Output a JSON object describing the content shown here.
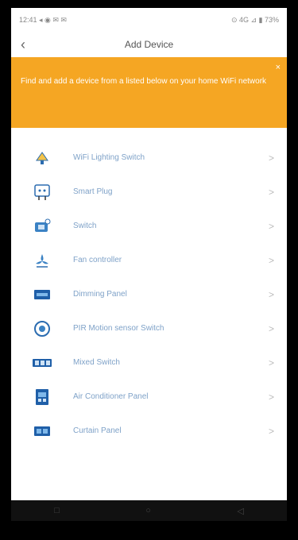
{
  "status": {
    "left": "12:41 ◂ ◉ ✉ ✉",
    "right": "⊙ 4G ⊿ ▮ 73%"
  },
  "header": {
    "title": "Add Device",
    "back_icon": "back-arrow-icon"
  },
  "banner": {
    "text": "Find and add a device from a listed below on your home WiFi network",
    "close_icon": "close-icon"
  },
  "devices": [
    {
      "label": "WiFi Lighting Switch",
      "icon": "lamp-icon"
    },
    {
      "label": "Smart Plug",
      "icon": "plug-icon"
    },
    {
      "label": "Switch",
      "icon": "switch-icon"
    },
    {
      "label": "Fan controller",
      "icon": "fan-icon"
    },
    {
      "label": "Dimming Panel",
      "icon": "panel-icon"
    },
    {
      "label": "PIR Motion sensor Switch",
      "icon": "motion-sensor-icon"
    },
    {
      "label": "Mixed Switch",
      "icon": "mixed-switch-icon"
    },
    {
      "label": "Air Conditioner Panel",
      "icon": "ac-panel-icon"
    },
    {
      "label": "Curtain Panel",
      "icon": "curtain-panel-icon"
    }
  ],
  "chevron": ">",
  "system_nav": {
    "square": "□",
    "circle": "○",
    "back": "◁"
  },
  "colors": {
    "accent": "#f5a623",
    "label": "#7fa2c8",
    "icon_blue": "#2b6cb0"
  }
}
